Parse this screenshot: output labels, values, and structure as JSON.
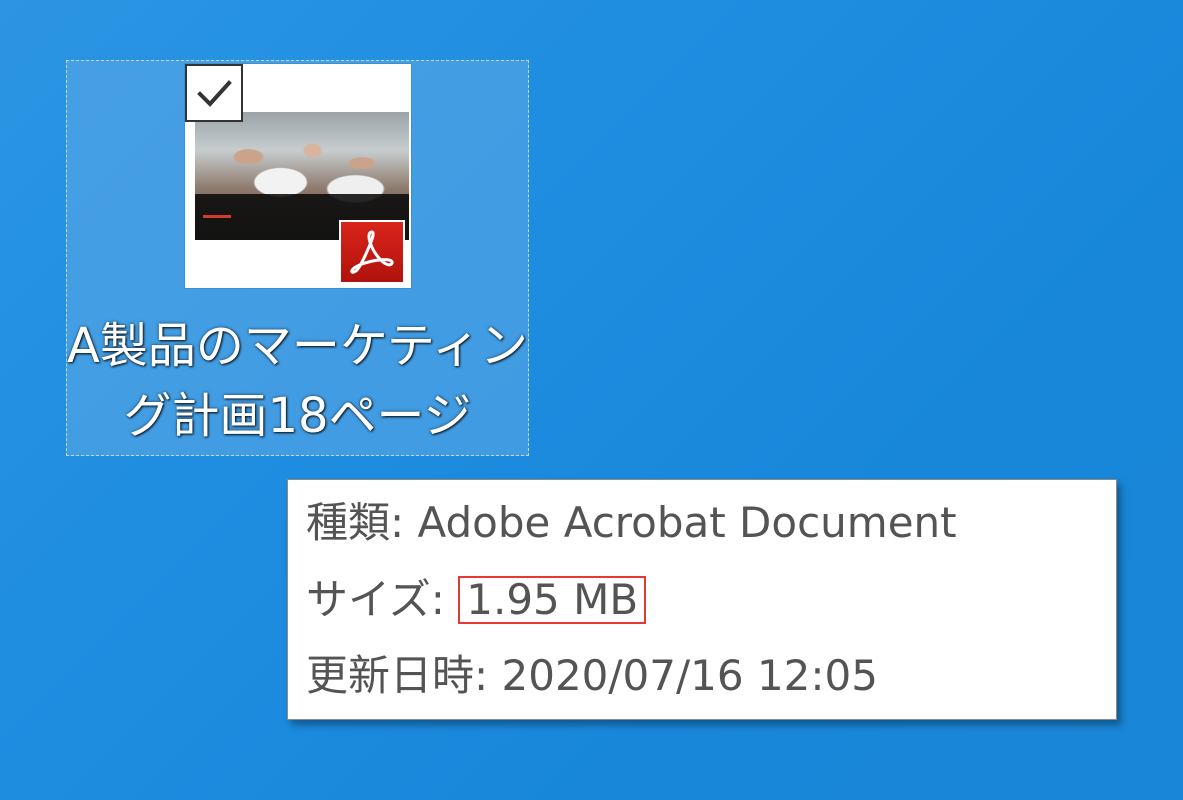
{
  "desktop": {
    "background_color": "#1f8de0",
    "selection_color": "#5faae6"
  },
  "file_icon": {
    "name_line1": "A製品のマーケティン",
    "name_line2": "グ計画18ページ",
    "selected": true,
    "checkbox_checked": true,
    "thumbnail": {
      "icon": "pdf-thumbnail-icon",
      "badge_icon": "adobe-acrobat-icon",
      "badge_color": "#c8161d"
    }
  },
  "tooltip": {
    "type_label": "種類: ",
    "type_value": "Adobe Acrobat Document",
    "size_label": "サイズ: ",
    "size_value": "1.95 MB",
    "modified_label": "更新日時: ",
    "modified_value": "2020/07/16 12:05",
    "highlight_color": "#e53935"
  }
}
